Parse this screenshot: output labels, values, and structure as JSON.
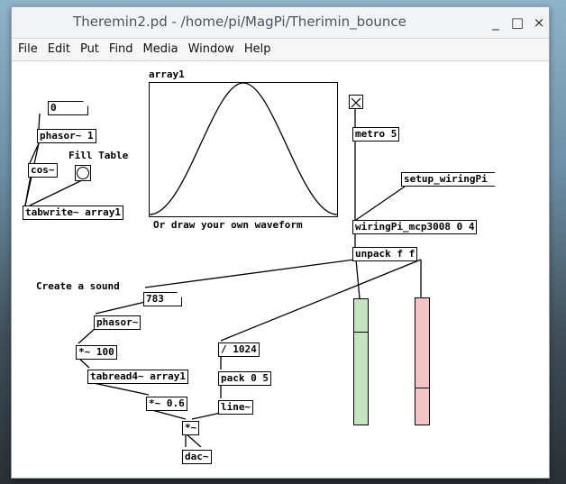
{
  "window": {
    "title": "Theremin2.pd  - /home/pi/MagPi/Therimin_bounce",
    "controls": {
      "minimize": "_",
      "maximize": "□",
      "close": "×"
    }
  },
  "menu": [
    "File",
    "Edit",
    "Put",
    "Find",
    "Media",
    "Window",
    "Help"
  ],
  "patch": {
    "number_0": "0",
    "phasor_1": "phasor~ 1",
    "cos": "cos~",
    "fill_table_label": "Fill Table",
    "tabwrite": "tabwrite~ array1",
    "array_name": "array1",
    "array_caption": "Or draw your own waveform",
    "metro": "metro 5",
    "setup_wiringpi": "setup_wiringPi",
    "wiringpi_mcp": "wiringPi_mcp3008 0 4",
    "unpack": "unpack f f",
    "create_sound_label": "Create a sound",
    "number_783": "783",
    "phasor": "phasor~",
    "mult_100": "*~ 100",
    "tabread": "tabread4~ array1",
    "mult_06": "*~ 0.6",
    "mult": "*~",
    "dac": "dac~",
    "div_1024": "/ 1024",
    "pack": "pack 0 5",
    "line": "line~"
  },
  "sliders": [
    {
      "name": "pitch-slider",
      "color": "#c5e2c1",
      "level": 0.79
    },
    {
      "name": "volume-slider",
      "color": "#f3c3c6",
      "level": 0.29
    }
  ],
  "colors": {
    "wire": "#000000",
    "window_bg": "#ffffff",
    "titlebar": "#f2f3f4"
  }
}
